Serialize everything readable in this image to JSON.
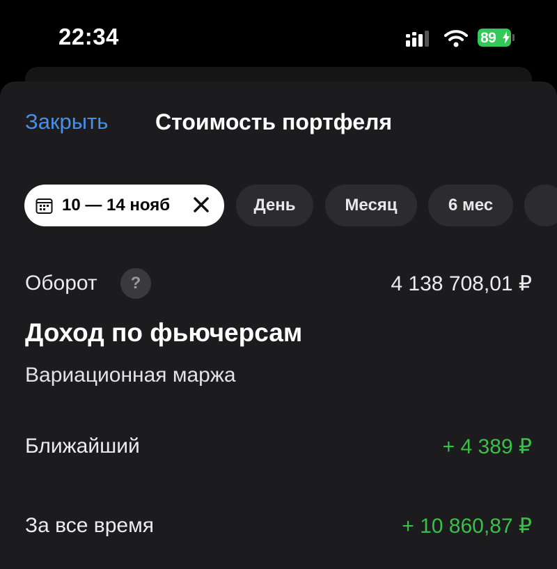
{
  "status_bar": {
    "time": "22:34",
    "battery": "89",
    "battery_color": "#34c759"
  },
  "sheet": {
    "close_label": "Закрыть",
    "title": "Стоимость портфеля",
    "accent_color": "#4a8fe6"
  },
  "periods": {
    "active": {
      "label": "10 — 14 нояб",
      "icon": "calendar-icon",
      "clear_icon": "close-icon"
    },
    "options": [
      "День",
      "Месяц",
      "6 мес"
    ]
  },
  "turnover": {
    "label": "Оборот",
    "help": "?",
    "value": "4 138 708,01 ₽"
  },
  "futures": {
    "title": "Доход по фьючерсам",
    "subtitle": "Вариационная маржа",
    "positive_color": "#3bbf4b",
    "rows": [
      {
        "label": "Ближайший",
        "value": "+ 4 389 ₽"
      },
      {
        "label": "За все время",
        "value": "+ 10 860,87 ₽"
      }
    ]
  }
}
